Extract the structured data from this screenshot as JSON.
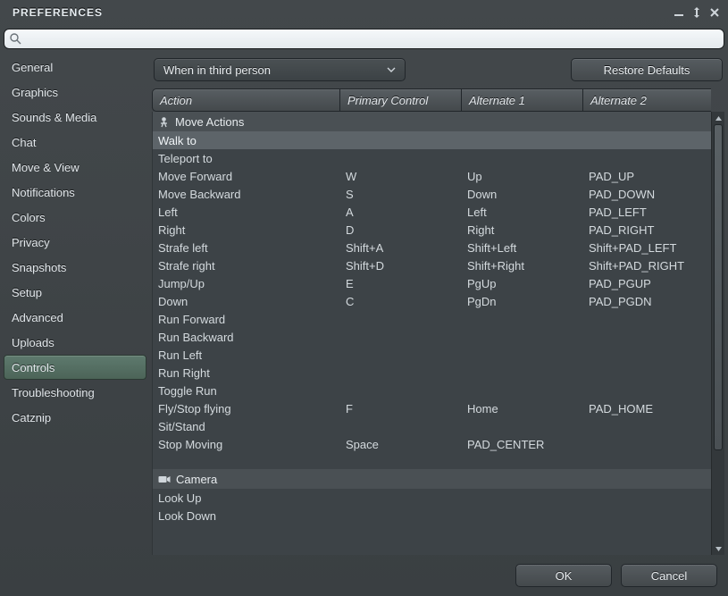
{
  "title": "PREFERENCES",
  "search": {
    "placeholder": ""
  },
  "sidebar": {
    "items": [
      {
        "label": "General"
      },
      {
        "label": "Graphics"
      },
      {
        "label": "Sounds & Media"
      },
      {
        "label": "Chat"
      },
      {
        "label": "Move & View"
      },
      {
        "label": "Notifications"
      },
      {
        "label": "Colors"
      },
      {
        "label": "Privacy"
      },
      {
        "label": "Snapshots"
      },
      {
        "label": "Setup"
      },
      {
        "label": "Advanced"
      },
      {
        "label": "Uploads"
      },
      {
        "label": "Controls"
      },
      {
        "label": "Troubleshooting"
      },
      {
        "label": "Catznip"
      }
    ],
    "active_index": 12
  },
  "toolbar": {
    "mode_selected": "When in third person",
    "restore_label": "Restore Defaults"
  },
  "columns": {
    "action": "Action",
    "primary": "Primary Control",
    "alt1": "Alternate 1",
    "alt2": "Alternate 2"
  },
  "groups": [
    {
      "icon": "person-icon",
      "title": "Move Actions",
      "rows": [
        {
          "action": "Walk to",
          "primary": "",
          "alt1": "",
          "alt2": "",
          "selected": true
        },
        {
          "action": "Teleport to",
          "primary": "",
          "alt1": "",
          "alt2": ""
        },
        {
          "action": "Move Forward",
          "primary": "W",
          "alt1": "Up",
          "alt2": "PAD_UP"
        },
        {
          "action": "Move Backward",
          "primary": "S",
          "alt1": "Down",
          "alt2": "PAD_DOWN"
        },
        {
          "action": "Left",
          "primary": "A",
          "alt1": "Left",
          "alt2": "PAD_LEFT"
        },
        {
          "action": "Right",
          "primary": "D",
          "alt1": "Right",
          "alt2": "PAD_RIGHT"
        },
        {
          "action": "Strafe left",
          "primary": "Shift+A",
          "alt1": "Shift+Left",
          "alt2": "Shift+PAD_LEFT"
        },
        {
          "action": "Strafe right",
          "primary": "Shift+D",
          "alt1": "Shift+Right",
          "alt2": "Shift+PAD_RIGHT"
        },
        {
          "action": "Jump/Up",
          "primary": "E",
          "alt1": "PgUp",
          "alt2": "PAD_PGUP"
        },
        {
          "action": "Down",
          "primary": "C",
          "alt1": "PgDn",
          "alt2": "PAD_PGDN"
        },
        {
          "action": "Run Forward",
          "primary": "",
          "alt1": "",
          "alt2": ""
        },
        {
          "action": "Run Backward",
          "primary": "",
          "alt1": "",
          "alt2": ""
        },
        {
          "action": "Run Left",
          "primary": "",
          "alt1": "",
          "alt2": ""
        },
        {
          "action": "Run Right",
          "primary": "",
          "alt1": "",
          "alt2": ""
        },
        {
          "action": "Toggle Run",
          "primary": "",
          "alt1": "",
          "alt2": ""
        },
        {
          "action": "Fly/Stop flying",
          "primary": "F",
          "alt1": "Home",
          "alt2": "PAD_HOME"
        },
        {
          "action": "Sit/Stand",
          "primary": "",
          "alt1": "",
          "alt2": ""
        },
        {
          "action": "Stop Moving",
          "primary": "Space",
          "alt1": "PAD_CENTER",
          "alt2": ""
        }
      ]
    },
    {
      "icon": "camera-icon",
      "title": "Camera",
      "rows": [
        {
          "action": "Look Up",
          "primary": "",
          "alt1": "",
          "alt2": ""
        },
        {
          "action": "Look Down",
          "primary": "",
          "alt1": "",
          "alt2": ""
        }
      ]
    }
  ],
  "footer": {
    "ok": "OK",
    "cancel": "Cancel"
  }
}
